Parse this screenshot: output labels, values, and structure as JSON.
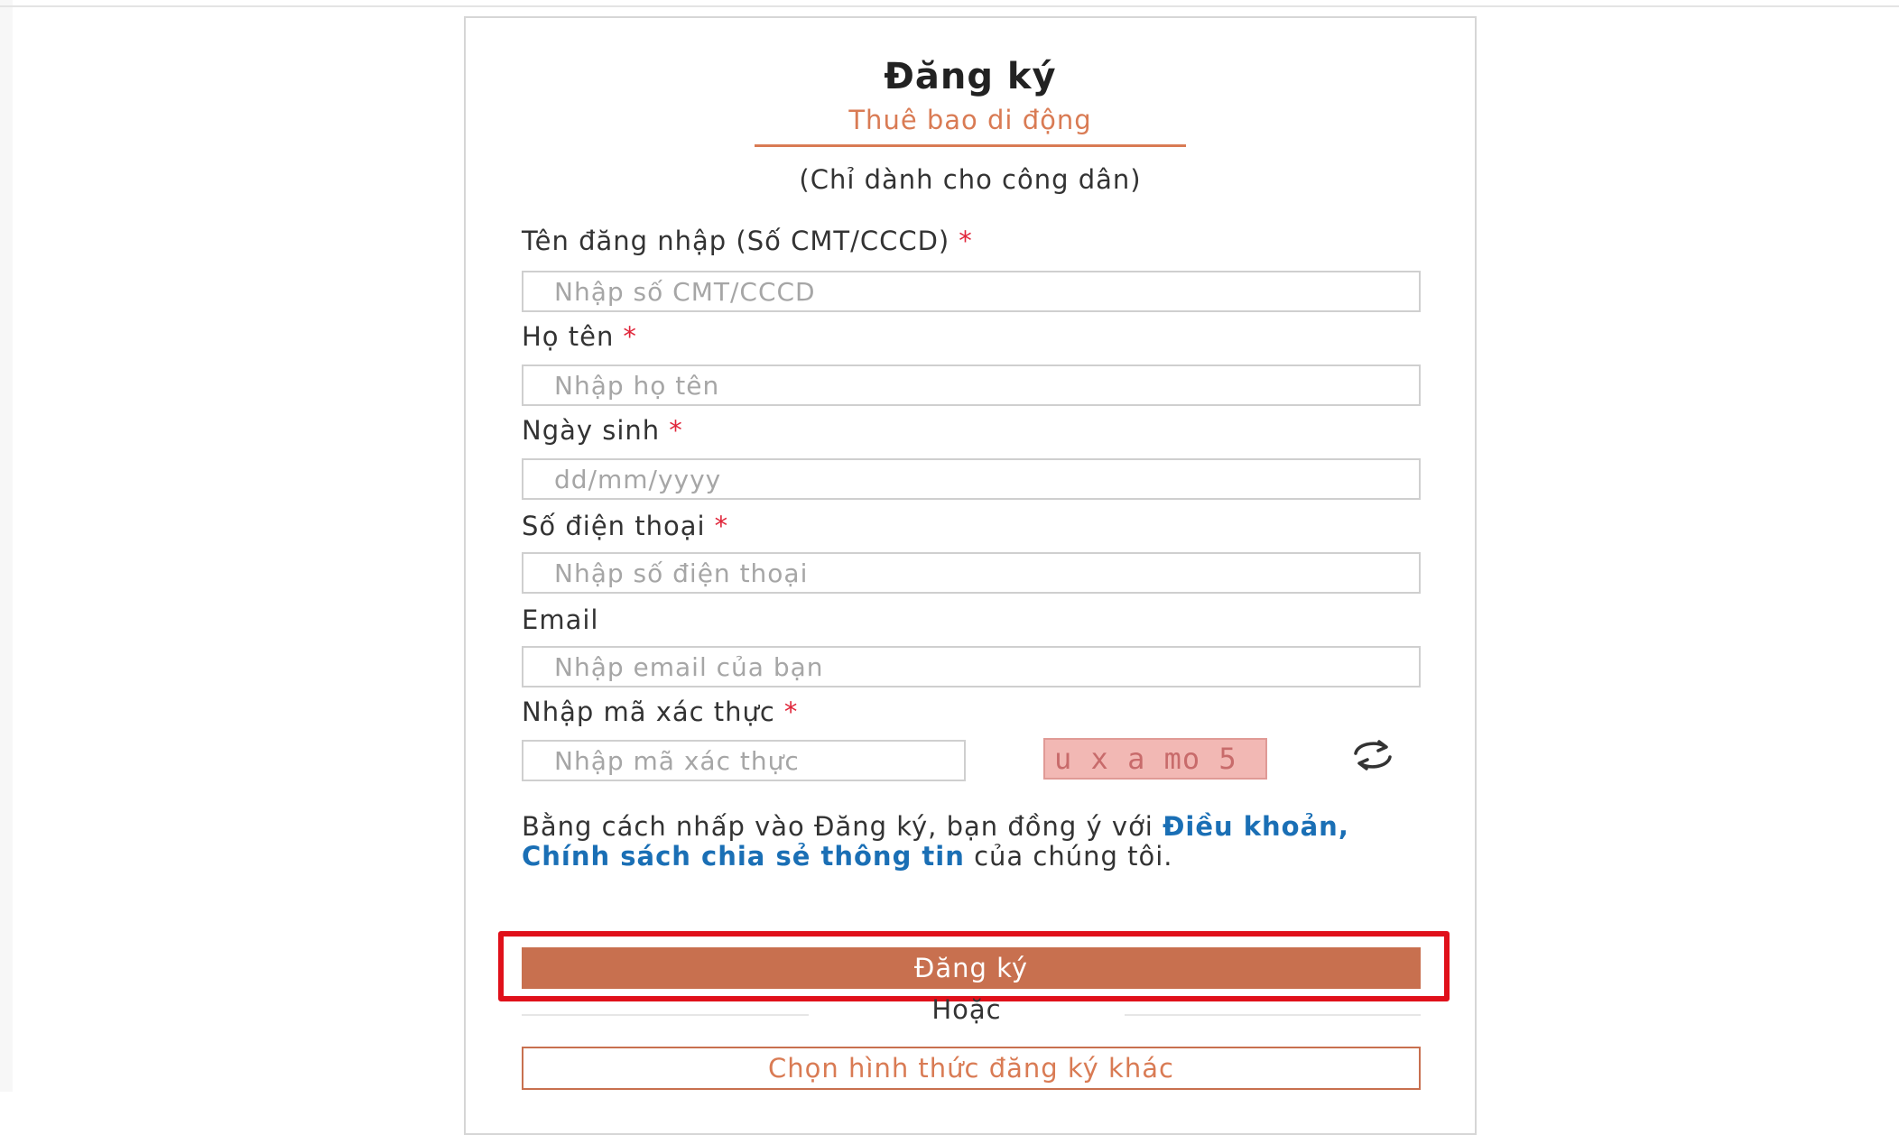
{
  "form": {
    "title": "Đăng ký",
    "subtitle": "Thuê bao di động",
    "note": "(Chỉ dành cho công dân)",
    "required_mark": "*",
    "fields": {
      "username": {
        "label": "Tên đăng nhập (Số CMT/CCCD)",
        "placeholder": "Nhập số CMT/CCCD",
        "required": true
      },
      "fullname": {
        "label": "Họ tên",
        "placeholder": "Nhập họ tên",
        "required": true
      },
      "dob": {
        "label": "Ngày sinh",
        "placeholder": "dd/mm/yyyy",
        "required": true
      },
      "phone": {
        "label": "Số điện thoại",
        "placeholder": "Nhập số điện thoại",
        "required": true
      },
      "email": {
        "label": "Email",
        "placeholder": "Nhập email của bạn",
        "required": false
      },
      "captcha": {
        "label": "Nhập mã xác thực",
        "placeholder": "Nhập mã xác thực",
        "required": true
      }
    },
    "captcha_image_text": "u x a mo 5",
    "refresh_icon": "refresh-icon",
    "terms": {
      "prefix": "Bằng cách nhấp vào Đăng ký, bạn đồng ý với ",
      "link": "Điều khoản, Chính sách chia sẻ thông tin",
      "suffix": " của chúng tôi."
    },
    "submit_label": "Đăng ký",
    "or_text": "Hoặc",
    "alt_button_label": "Chọn hình thức đăng ký khác"
  },
  "colors": {
    "accent": "#c8704f",
    "subtitle": "#d97b54",
    "link": "#1a6fb5",
    "required": "#e0263a",
    "highlight": "#e0101a",
    "captcha_bg": "#f2b8b4"
  }
}
